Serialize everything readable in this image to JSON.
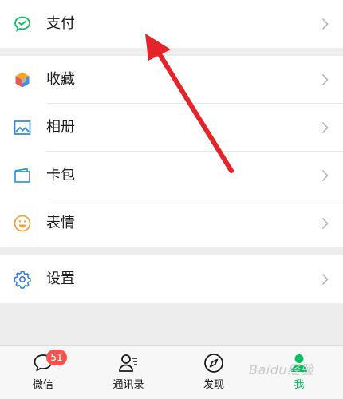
{
  "menu": {
    "pay": {
      "label": "支付",
      "icon": "wechat-pay-icon"
    },
    "items": [
      {
        "label": "收藏",
        "icon": "favorites-cube-icon"
      },
      {
        "label": "相册",
        "icon": "album-image-icon"
      },
      {
        "label": "卡包",
        "icon": "card-wallet-icon"
      },
      {
        "label": "表情",
        "icon": "sticker-smiley-icon"
      }
    ],
    "settings": {
      "label": "设置",
      "icon": "gear-icon"
    }
  },
  "tabbar": {
    "tabs": [
      {
        "label": "微信",
        "icon": "chat-bubble-icon",
        "badge": "51"
      },
      {
        "label": "通讯录",
        "icon": "contacts-icon"
      },
      {
        "label": "发现",
        "icon": "compass-icon"
      },
      {
        "label": "我",
        "icon": "person-icon",
        "active": true
      }
    ]
  },
  "watermark": "Baidu经验",
  "colors": {
    "accent": "#07c160",
    "badge": "#fa5151",
    "arrow": "#e5232a",
    "background": "#ededed"
  }
}
